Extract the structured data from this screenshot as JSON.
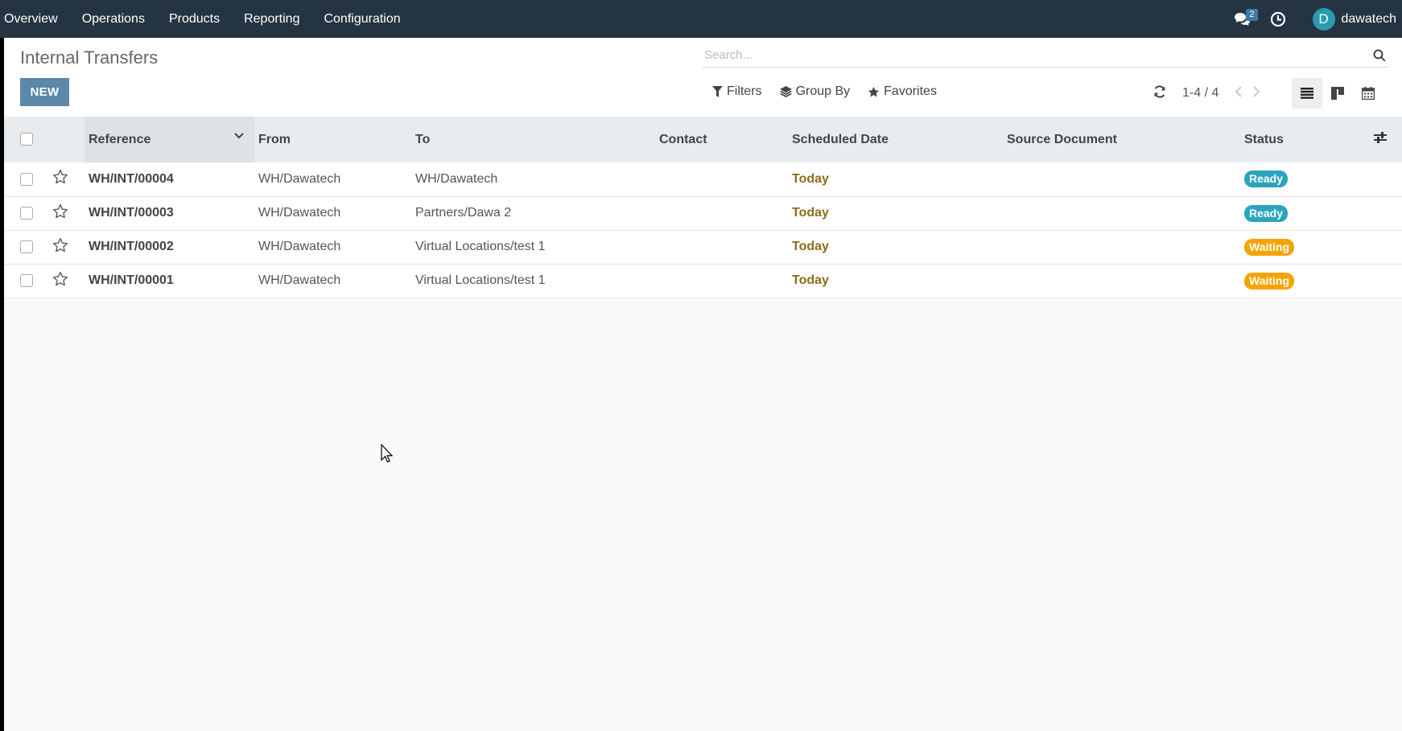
{
  "navbar": {
    "menu": [
      "Overview",
      "Operations",
      "Products",
      "Reporting",
      "Configuration"
    ],
    "messages_badge": "2",
    "user_initial": "D",
    "user_name": "dawatech"
  },
  "control": {
    "title": "Internal Transfers",
    "new_label": "NEW",
    "search_placeholder": "Search...",
    "filters_label": "Filters",
    "groupby_label": "Group By",
    "favorites_label": "Favorites",
    "pager_value": "1-4 / 4"
  },
  "table": {
    "columns": [
      "Reference",
      "From",
      "To",
      "Contact",
      "Scheduled Date",
      "Source Document",
      "Status"
    ],
    "rows": [
      {
        "reference": "WH/INT/00004",
        "from": "WH/Dawatech",
        "to": "WH/Dawatech",
        "contact": "",
        "date": "Today",
        "source": "",
        "status": "Ready"
      },
      {
        "reference": "WH/INT/00003",
        "from": "WH/Dawatech",
        "to": "Partners/Dawa 2",
        "contact": "",
        "date": "Today",
        "source": "",
        "status": "Ready"
      },
      {
        "reference": "WH/INT/00002",
        "from": "WH/Dawatech",
        "to": "Virtual Locations/test 1",
        "contact": "",
        "date": "Today",
        "source": "",
        "status": "Waiting"
      },
      {
        "reference": "WH/INT/00001",
        "from": "WH/Dawatech",
        "to": "Virtual Locations/test 1",
        "contact": "",
        "date": "Today",
        "source": "",
        "status": "Waiting"
      }
    ]
  },
  "colors": {
    "navbar": "#243442",
    "new_button": "#5b87a8",
    "ready": "#2aa4bd",
    "waiting": "#f5a300",
    "date": "#8a6d1c",
    "avatar": "#2a9bb0"
  }
}
